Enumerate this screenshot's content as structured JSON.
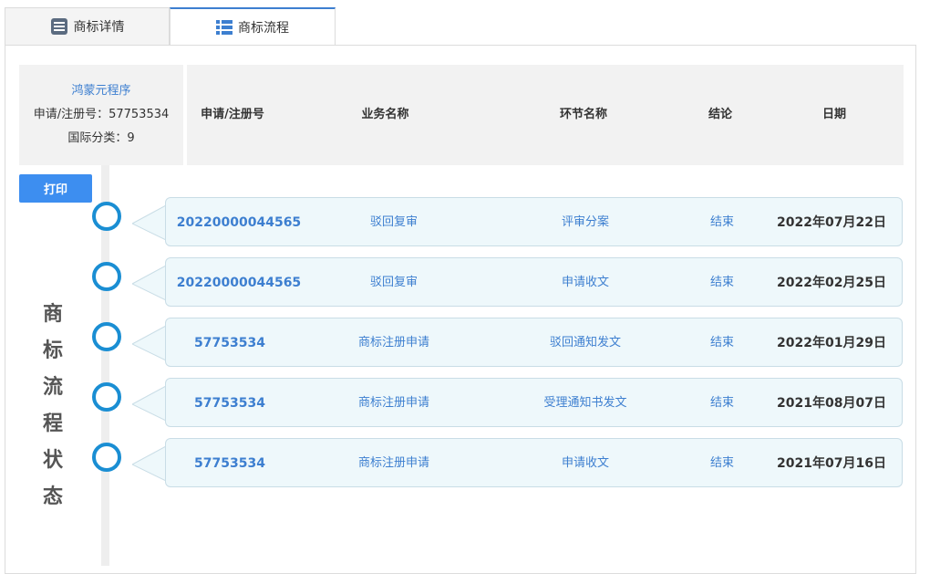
{
  "tabs": [
    {
      "label": "商标详情",
      "icon": "document-list-icon",
      "active": false
    },
    {
      "label": "商标流程",
      "icon": "list-icon",
      "active": true
    }
  ],
  "info": {
    "name": "鸿蒙元程序",
    "reg_line": "申请/注册号：57753534",
    "class_line": "国际分类：9"
  },
  "columns": [
    "申请/注册号",
    "业务名称",
    "环节名称",
    "结论",
    "日期"
  ],
  "print_label": "打印",
  "side_title": [
    "商",
    "标",
    "流",
    "程",
    "状",
    "态"
  ],
  "rows": [
    {
      "number": "20220000044565",
      "business": "驳回复审",
      "stage": "评审分案",
      "result": "结束",
      "date": "2022年07月22日"
    },
    {
      "number": "20220000044565",
      "business": "驳回复审",
      "stage": "申请收文",
      "result": "结束",
      "date": "2022年02月25日"
    },
    {
      "number": "57753534",
      "business": "商标注册申请",
      "stage": "驳回通知发文",
      "result": "结束",
      "date": "2022年01月29日"
    },
    {
      "number": "57753534",
      "business": "商标注册申请",
      "stage": "受理通知书发文",
      "result": "结束",
      "date": "2021年08月07日"
    },
    {
      "number": "57753534",
      "business": "商标注册申请",
      "stage": "申请收文",
      "result": "结束",
      "date": "2021年07月16日"
    }
  ],
  "colors": {
    "accent": "#3d7fd0",
    "button": "#3d8ef0",
    "circle": "#1a8ed3",
    "card": "#eef8fb"
  }
}
